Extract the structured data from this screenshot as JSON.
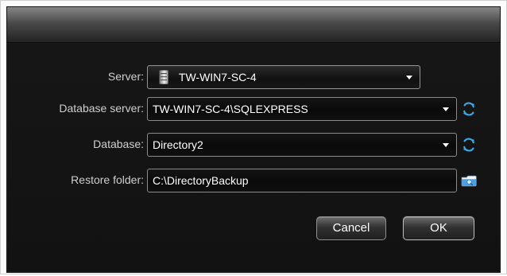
{
  "dialog": {
    "fields": {
      "server": {
        "label": "Server:",
        "value": "TW-WIN7-SC-4",
        "icon": "server-icon"
      },
      "database_server": {
        "label": "Database server:",
        "value": "TW-WIN7-SC-4\\SQLEXPRESS",
        "action_icon": "refresh-icon"
      },
      "database": {
        "label": "Database:",
        "value": "Directory2",
        "action_icon": "refresh-icon"
      },
      "restore_folder": {
        "label": "Restore folder:",
        "value": "C:\\DirectoryBackup",
        "action_icon": "folder-browse-icon"
      }
    },
    "buttons": {
      "cancel": "Cancel",
      "ok": "OK"
    },
    "colors": {
      "accent_blue": "#3ba7e6",
      "text": "#ffffff",
      "label": "#cfcfcf",
      "background": "#161616"
    }
  }
}
